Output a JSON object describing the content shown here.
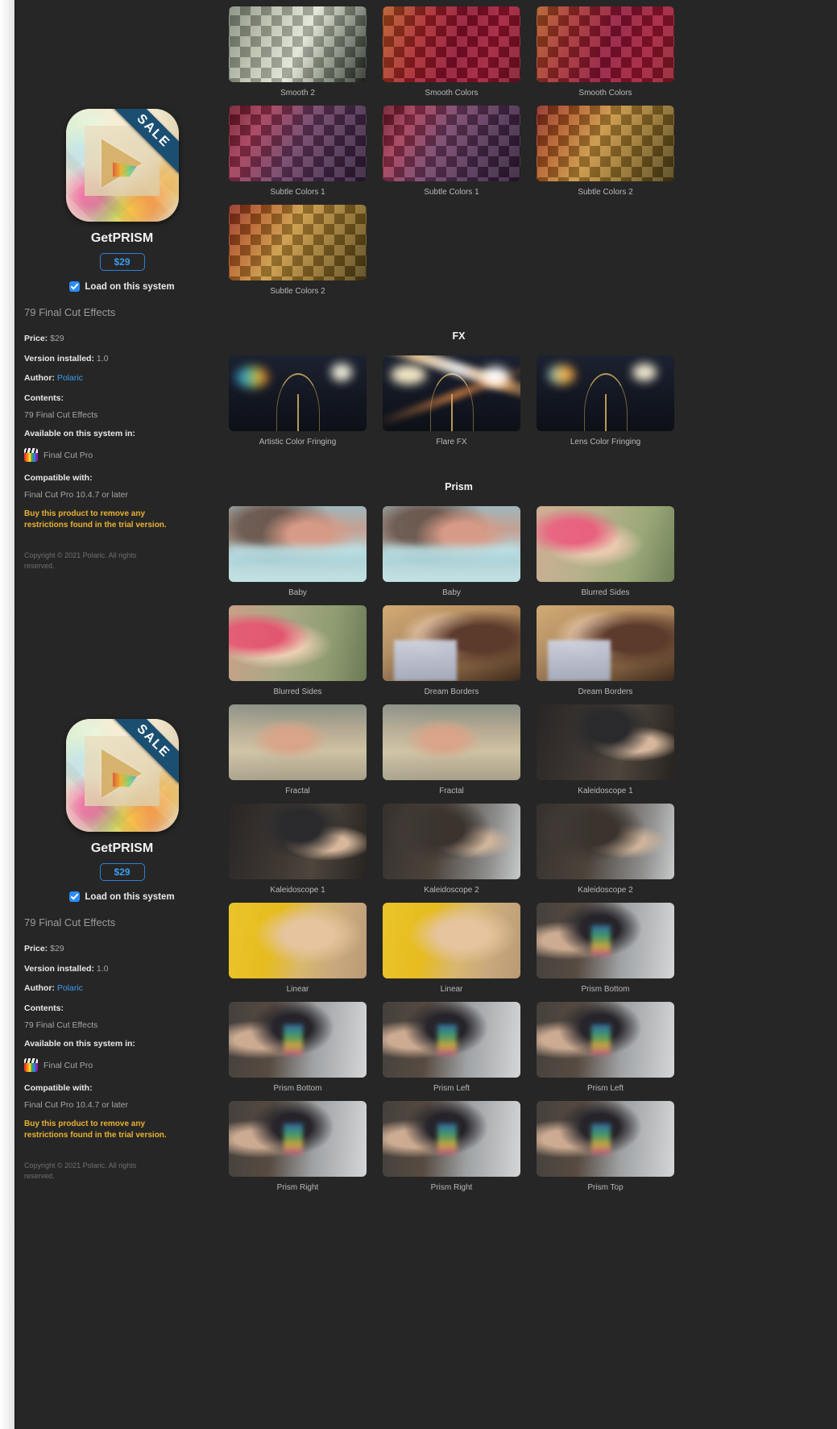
{
  "product": {
    "title": "GetPRISM",
    "ribbon": "SALE",
    "price_pill": "$29",
    "load_checkbox_label": "Load on this system",
    "effects_count": "79 Final Cut Effects",
    "meta": {
      "price_key": "Price:",
      "price_value": "$29",
      "version_key": "Version installed:",
      "version_value": "1.0",
      "author_key": "Author:",
      "author_value": "Polaric",
      "contents_key": "Contents:",
      "contents_value": "79 Final Cut Effects",
      "available_key": "Available on this system in:",
      "available_app": "Final Cut Pro",
      "compatible_key": "Compatible with:",
      "compatible_value": "Final Cut Pro 10.4.7 or later"
    },
    "warning": "Buy this product to remove any restrictions found in the trial version.",
    "copyright": "Copyright © 2021 Polaric. All rights reserved."
  },
  "colors": {
    "accent_blue": "#3b9cf0",
    "warning_amber": "#e8b233",
    "ribbon_blue": "#1b4f72",
    "background": "#262626",
    "checkbox_blue": "#2b8cf5"
  },
  "sections": [
    {
      "title": "",
      "items": [
        {
          "label": "Smooth 2",
          "style": "p-smooth2",
          "kind": "pattern"
        },
        {
          "label": "Smooth Colors",
          "style": "p-smoothc1",
          "kind": "pattern"
        },
        {
          "label": "Smooth Colors",
          "style": "p-smoothc2",
          "kind": "pattern"
        },
        {
          "label": "Subtle Colors 1",
          "style": "p-sub1a",
          "kind": "pattern"
        },
        {
          "label": "Subtle Colors 1",
          "style": "p-sub1b",
          "kind": "pattern"
        },
        {
          "label": "Subtle Colors 2",
          "style": "p-sub2a",
          "kind": "pattern"
        },
        {
          "label": "Subtle Colors 2",
          "style": "p-sub2b",
          "kind": "pattern"
        }
      ]
    },
    {
      "title": "FX",
      "items": [
        {
          "label": "Artistic Color Fringing",
          "style": "fx-a",
          "kind": "fx"
        },
        {
          "label": "Flare FX",
          "style": "fx-b",
          "kind": "fx"
        },
        {
          "label": "Lens Color Fringing",
          "style": "fx-c",
          "kind": "fx"
        }
      ]
    },
    {
      "title": "Prism",
      "items": [
        {
          "label": "Baby",
          "style": "ph-baby",
          "kind": "photo"
        },
        {
          "label": "Baby",
          "style": "ph-baby",
          "kind": "photo"
        },
        {
          "label": "Blurred Sides",
          "style": "ph-blur",
          "kind": "photo"
        },
        {
          "label": "Blurred Sides",
          "style": "ph-blur2",
          "kind": "photo"
        },
        {
          "label": "Dream Borders",
          "style": "ph-dream",
          "kind": "photo"
        },
        {
          "label": "Dream Borders",
          "style": "ph-dream",
          "kind": "photo"
        },
        {
          "label": "Fractal",
          "style": "ph-fractal",
          "kind": "photo"
        },
        {
          "label": "Fractal",
          "style": "ph-fractal",
          "kind": "photo"
        },
        {
          "label": "Kaleidoscope 1",
          "style": "ph-kal",
          "kind": "photo"
        },
        {
          "label": "Kaleidoscope 1",
          "style": "ph-kal",
          "kind": "photo"
        },
        {
          "label": "Kaleidoscope 2",
          "style": "ph-kal2",
          "kind": "photo"
        },
        {
          "label": "Kaleidoscope 2",
          "style": "ph-kal2",
          "kind": "photo"
        },
        {
          "label": "Linear",
          "style": "ph-linear",
          "kind": "photo"
        },
        {
          "label": "Linear",
          "style": "ph-linear",
          "kind": "photo"
        },
        {
          "label": "Prism Bottom",
          "style": "ph-prism",
          "kind": "photo"
        },
        {
          "label": "Prism Bottom",
          "style": "ph-prism",
          "kind": "photo"
        },
        {
          "label": "Prism Left",
          "style": "ph-prism",
          "kind": "photo"
        },
        {
          "label": "Prism Left",
          "style": "ph-prism",
          "kind": "photo"
        },
        {
          "label": "Prism Right",
          "style": "ph-prism",
          "kind": "photo"
        },
        {
          "label": "Prism Right",
          "style": "ph-prism",
          "kind": "photo"
        },
        {
          "label": "Prism Top",
          "style": "ph-prism",
          "kind": "photo"
        }
      ]
    }
  ]
}
